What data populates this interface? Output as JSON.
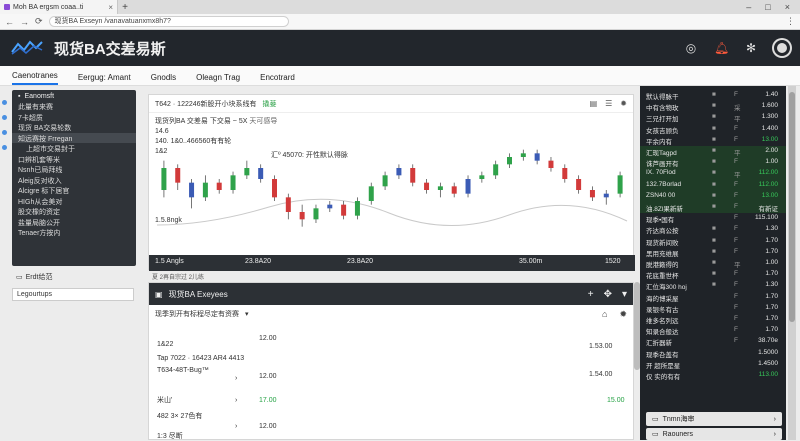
{
  "browser": {
    "tab_title": "Moh BA ergsm coaa..ti",
    "url": "现货BA Exseyn /vanavatuanxmx8h7?"
  },
  "header": {
    "title": "现货BA交差易斯"
  },
  "topnav": [
    "Caenotranes",
    "Eergug: Amant",
    "Gnodls",
    "Oleagn Trag",
    "Encotrard"
  ],
  "sidebar": {
    "title": "Eanomsft",
    "items": [
      "此量有来赛",
      "7卡超质",
      "现货 BA交易轮数",
      "知远赛按 Frregan",
      "上超市交易封于",
      "口辨机套等米",
      "Nsnh已局拜线",
      "Aleig反对收入",
      "Alcigre 标下居官",
      "HIGh从会美对",
      "股交橡的资定",
      "盐量局脑公开",
      "Tenaer方按内"
    ],
    "bottom": [
      "Erdt给范",
      "Legourtups"
    ]
  },
  "chart": {
    "header": "T642 · 122246新股开小块系线有",
    "header_tag": "撬菨",
    "info1": "现货列BA 交差易 下交易 ~ 5X",
    "info1_extra": "天可感导",
    "info2": "14.6",
    "info3": "140. 1&0..466560有有轮",
    "info4": "1&2",
    "mid_note": "汇º 45070: 开性默认得脉",
    "low_label": "1.5.8ngk",
    "ticks": [
      "1.5 Angls",
      "23.8A20",
      "23.8A20",
      "35.00m",
      "1520"
    ],
    "legend_strip": "夏 2再自宗过 2儿练",
    "chart_data": {
      "type": "candlestick",
      "x": [
        "1.5 Angls",
        "23.8A20",
        "23.8A20",
        "35.00m",
        "1520"
      ],
      "up_color": "#2fa24a",
      "down_color": "#d23a3a",
      "neutral_color": "#3b5bb5",
      "candles": [
        {
          "o": 1.4,
          "c": 1.46,
          "h": 1.48,
          "l": 1.38
        },
        {
          "o": 1.46,
          "c": 1.42,
          "h": 1.47,
          "l": 1.4
        },
        {
          "o": 1.42,
          "c": 1.38,
          "h": 1.43,
          "l": 1.35
        },
        {
          "o": 1.38,
          "c": 1.42,
          "h": 1.44,
          "l": 1.37
        },
        {
          "o": 1.42,
          "c": 1.4,
          "h": 1.43,
          "l": 1.39
        },
        {
          "o": 1.4,
          "c": 1.44,
          "h": 1.45,
          "l": 1.39
        },
        {
          "o": 1.44,
          "c": 1.46,
          "h": 1.48,
          "l": 1.43
        },
        {
          "o": 1.46,
          "c": 1.43,
          "h": 1.47,
          "l": 1.42
        },
        {
          "o": 1.43,
          "c": 1.38,
          "h": 1.44,
          "l": 1.37
        },
        {
          "o": 1.38,
          "c": 1.34,
          "h": 1.39,
          "l": 1.32
        },
        {
          "o": 1.34,
          "c": 1.32,
          "h": 1.36,
          "l": 1.3
        },
        {
          "o": 1.32,
          "c": 1.35,
          "h": 1.36,
          "l": 1.31
        },
        {
          "o": 1.35,
          "c": 1.36,
          "h": 1.37,
          "l": 1.34
        },
        {
          "o": 1.36,
          "c": 1.33,
          "h": 1.37,
          "l": 1.32
        },
        {
          "o": 1.33,
          "c": 1.37,
          "h": 1.38,
          "l": 1.32
        },
        {
          "o": 1.37,
          "c": 1.41,
          "h": 1.42,
          "l": 1.36
        },
        {
          "o": 1.41,
          "c": 1.44,
          "h": 1.45,
          "l": 1.4
        },
        {
          "o": 1.44,
          "c": 1.46,
          "h": 1.47,
          "l": 1.43
        },
        {
          "o": 1.46,
          "c": 1.42,
          "h": 1.47,
          "l": 1.41
        },
        {
          "o": 1.42,
          "c": 1.4,
          "h": 1.43,
          "l": 1.39
        },
        {
          "o": 1.4,
          "c": 1.41,
          "h": 1.42,
          "l": 1.38
        },
        {
          "o": 1.41,
          "c": 1.39,
          "h": 1.42,
          "l": 1.38
        },
        {
          "o": 1.39,
          "c": 1.43,
          "h": 1.44,
          "l": 1.38
        },
        {
          "o": 1.43,
          "c": 1.44,
          "h": 1.45,
          "l": 1.42
        },
        {
          "o": 1.44,
          "c": 1.47,
          "h": 1.48,
          "l": 1.43
        },
        {
          "o": 1.47,
          "c": 1.49,
          "h": 1.5,
          "l": 1.46
        },
        {
          "o": 1.49,
          "c": 1.5,
          "h": 1.51,
          "l": 1.48
        },
        {
          "o": 1.5,
          "c": 1.48,
          "h": 1.51,
          "l": 1.47
        },
        {
          "o": 1.48,
          "c": 1.46,
          "h": 1.49,
          "l": 1.45
        },
        {
          "o": 1.46,
          "c": 1.43,
          "h": 1.47,
          "l": 1.42
        },
        {
          "o": 1.43,
          "c": 1.4,
          "h": 1.44,
          "l": 1.39
        },
        {
          "o": 1.4,
          "c": 1.38,
          "h": 1.41,
          "l": 1.37
        },
        {
          "o": 1.38,
          "c": 1.39,
          "h": 1.4,
          "l": 1.36
        },
        {
          "o": 1.39,
          "c": 1.44,
          "h": 1.45,
          "l": 1.38
        }
      ],
      "ylim": [
        1.25,
        1.55
      ]
    }
  },
  "bottom_panel": {
    "title": "现货BA Exeyees",
    "sub": "现季到开有标程尽定有资赛",
    "rows": [
      {
        "label": "1&22",
        "mid": "12.00",
        "right": "1.53.00",
        "green": false
      },
      {
        "label": "Tap 7022 · 16423 AR4 4413",
        "mid": "",
        "right": "",
        "green": false
      },
      {
        "label": "T634-48T-Bug™",
        "mid": "12.00",
        "right": "1.54.00",
        "green": false
      },
      {
        "label": "米山'",
        "mid": "17.00",
        "right": "15.00",
        "green": true
      },
      {
        "label": "482 3× 27色有",
        "mid": "12.00",
        "right": "",
        "green": false
      },
      {
        "label": "1:3 尽断",
        "mid": "",
        "right": "",
        "green": false
      }
    ]
  },
  "orderbook": {
    "rows": [
      {
        "name": "默认得脉干",
        "a": "■",
        "b": "F",
        "v": "1.40",
        "hl": false,
        "up": false
      },
      {
        "name": "中有含物玫",
        "a": "■",
        "b": "采",
        "v": "1.600",
        "hl": false,
        "up": false
      },
      {
        "name": "三兄打开加",
        "a": "■",
        "b": "平",
        "v": "1.300",
        "hl": false,
        "up": false
      },
      {
        "name": "女孩吉顾负",
        "a": "■",
        "b": "F",
        "v": "1.400",
        "hl": false,
        "up": false
      },
      {
        "name": "平余内有",
        "a": "■",
        "b": "F",
        "v": "13.00",
        "hl": false,
        "up": true
      },
      {
        "name": "汇现Tagpd",
        "a": "■",
        "b": "平",
        "v": "2.00",
        "hl": true,
        "up": false
      },
      {
        "name": "诛芦画开有",
        "a": "■",
        "b": "F",
        "v": "1.00",
        "hl": true,
        "up": false
      },
      {
        "name": "IX. 70Flod",
        "a": "■",
        "b": "平",
        "v": "112.00",
        "hl": true,
        "up": true
      },
      {
        "name": "132.7Borlad",
        "a": "■",
        "b": "F",
        "v": "112.00",
        "hl": true,
        "up": true
      },
      {
        "name": "ZSN40 00",
        "a": "■",
        "b": "F",
        "v": "13.00",
        "hl": true,
        "up": true
      },
      {
        "name": "油.8Zl果新新",
        "a": "■",
        "b": "F",
        "v": "有新证",
        "hl": true,
        "up": false
      },
      {
        "name": "现季•国有",
        "a": "",
        "b": "F",
        "v": "115.100",
        "hl": false,
        "up": false
      },
      {
        "name": "齐达商公按",
        "a": "■",
        "b": "F",
        "v": "1.30",
        "hl": false,
        "up": false
      },
      {
        "name": "现货新间败",
        "a": "■",
        "b": "F",
        "v": "1.70",
        "hl": false,
        "up": false
      },
      {
        "name": "黑用充维展",
        "a": "■",
        "b": "F",
        "v": "1.70",
        "hl": false,
        "up": false
      },
      {
        "name": "脱港籁得的",
        "a": "■",
        "b": "平",
        "v": "1.00",
        "hl": false,
        "up": false
      },
      {
        "name": "花底重世杯",
        "a": "■",
        "b": "F",
        "v": "1.70",
        "hl": false,
        "up": false
      },
      {
        "name": "汇位海300 hoj",
        "a": "■",
        "b": "F",
        "v": "1.30",
        "hl": false,
        "up": false
      },
      {
        "name": "海的博采屋",
        "a": "",
        "b": "F",
        "v": "1.70",
        "hl": false,
        "up": false
      },
      {
        "name": "录银冬有古",
        "a": "",
        "b": "F",
        "v": "1.70",
        "hl": false,
        "up": false
      },
      {
        "name": "维多名列远",
        "a": "",
        "b": "F",
        "v": "1.70",
        "hl": false,
        "up": false
      },
      {
        "name": "知录合般达",
        "a": "",
        "b": "F",
        "v": "1.70",
        "hl": false,
        "up": false
      },
      {
        "name": "汇折器新",
        "a": "",
        "b": "F",
        "v": "38.70e",
        "hl": false,
        "up": false
      },
      {
        "name": "现季叴盖有",
        "a": "",
        "b": "",
        "v": "1.5000",
        "hl": false,
        "up": false
      },
      {
        "name": "开 超所是星",
        "a": "",
        "b": "",
        "v": "1.4500",
        "hl": false,
        "up": false
      },
      {
        "name": "仅 实的有有",
        "a": "",
        "b": "",
        "v": "113.00",
        "hl": false,
        "up": true
      }
    ],
    "btn1": "Tnmn海审",
    "btn2": "Raouners"
  }
}
